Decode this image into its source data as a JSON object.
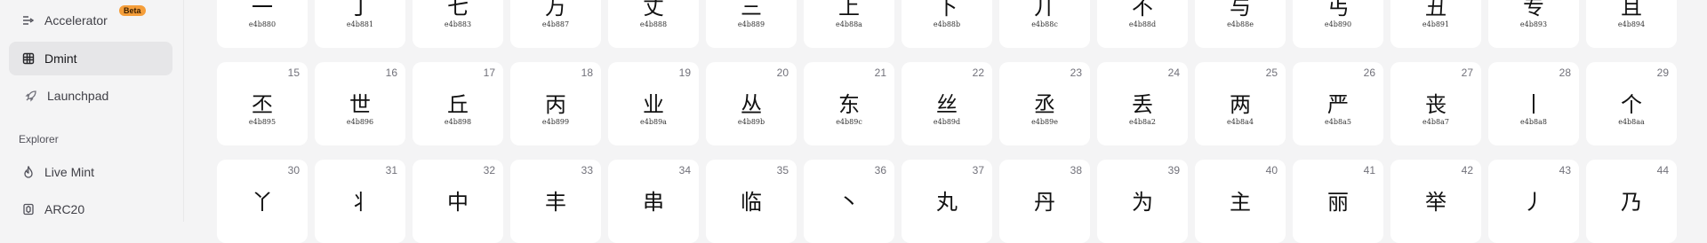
{
  "sidebar": {
    "items": [
      {
        "label": "Accelerator",
        "icon": "accelerator-icon",
        "badge": "Beta"
      },
      {
        "label": "Dmint",
        "icon": "grid-icon",
        "active": true
      },
      {
        "label": "Launchpad",
        "icon": "rocket-icon"
      }
    ],
    "section_title": "Explorer",
    "explorer_items": [
      {
        "label": "Live Mint",
        "icon": "flame-icon"
      },
      {
        "label": "ARC20",
        "icon": "token-icon"
      }
    ]
  },
  "grid": {
    "rows": [
      [
        {
          "glyph": "一",
          "code": "e4b880"
        },
        {
          "glyph": "丁",
          "code": "e4b881"
        },
        {
          "glyph": "七",
          "code": "e4b883"
        },
        {
          "glyph": "万",
          "code": "e4b887"
        },
        {
          "glyph": "丈",
          "code": "e4b888"
        },
        {
          "glyph": "三",
          "code": "e4b889"
        },
        {
          "glyph": "上",
          "code": "e4b88a"
        },
        {
          "glyph": "下",
          "code": "e4b88b"
        },
        {
          "glyph": "丌",
          "code": "e4b88c"
        },
        {
          "glyph": "不",
          "code": "e4b88d"
        },
        {
          "glyph": "与",
          "code": "e4b88e"
        },
        {
          "glyph": "丐",
          "code": "e4b890"
        },
        {
          "glyph": "丑",
          "code": "e4b891"
        },
        {
          "glyph": "专",
          "code": "e4b893"
        },
        {
          "glyph": "且",
          "code": "e4b894"
        }
      ],
      [
        {
          "idx": "15",
          "glyph": "丕",
          "code": "e4b895"
        },
        {
          "idx": "16",
          "glyph": "世",
          "code": "e4b896"
        },
        {
          "idx": "17",
          "glyph": "丘",
          "code": "e4b898"
        },
        {
          "idx": "18",
          "glyph": "丙",
          "code": "e4b899"
        },
        {
          "idx": "19",
          "glyph": "业",
          "code": "e4b89a"
        },
        {
          "idx": "20",
          "glyph": "丛",
          "code": "e4b89b"
        },
        {
          "idx": "21",
          "glyph": "东",
          "code": "e4b89c"
        },
        {
          "idx": "22",
          "glyph": "丝",
          "code": "e4b89d"
        },
        {
          "idx": "23",
          "glyph": "丞",
          "code": "e4b89e"
        },
        {
          "idx": "24",
          "glyph": "丢",
          "code": "e4b8a2"
        },
        {
          "idx": "25",
          "glyph": "两",
          "code": "e4b8a4"
        },
        {
          "idx": "26",
          "glyph": "严",
          "code": "e4b8a5"
        },
        {
          "idx": "27",
          "glyph": "丧",
          "code": "e4b8a7"
        },
        {
          "idx": "28",
          "glyph": "丨",
          "code": "e4b8a8"
        },
        {
          "idx": "29",
          "glyph": "个",
          "code": "e4b8aa"
        }
      ],
      [
        {
          "idx": "30",
          "glyph": "丫"
        },
        {
          "idx": "31",
          "glyph": "丬"
        },
        {
          "idx": "32",
          "glyph": "中"
        },
        {
          "idx": "33",
          "glyph": "丰"
        },
        {
          "idx": "34",
          "glyph": "串"
        },
        {
          "idx": "35",
          "glyph": "临"
        },
        {
          "idx": "36",
          "glyph": "丶"
        },
        {
          "idx": "37",
          "glyph": "丸"
        },
        {
          "idx": "38",
          "glyph": "丹"
        },
        {
          "idx": "39",
          "glyph": "为"
        },
        {
          "idx": "40",
          "glyph": "主"
        },
        {
          "idx": "41",
          "glyph": "丽"
        },
        {
          "idx": "42",
          "glyph": "举"
        },
        {
          "idx": "43",
          "glyph": "丿"
        },
        {
          "idx": "44",
          "glyph": "乃"
        }
      ]
    ]
  }
}
